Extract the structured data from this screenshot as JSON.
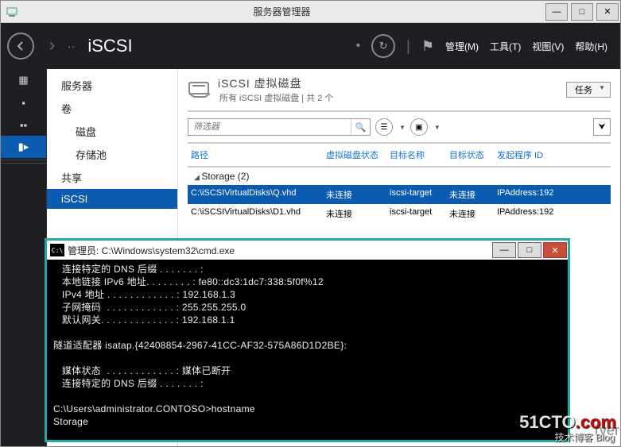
{
  "window": {
    "title": "服务器管理器",
    "min": "—",
    "max": "□",
    "close": "✕"
  },
  "header": {
    "breadcrumb": "iSCSI",
    "refresh": "↻",
    "menus": {
      "manage": "管理(M)",
      "tools": "工具(T)",
      "view": "视图(V)",
      "help": "帮助(H)"
    }
  },
  "sidebar": {
    "items": [
      "服务器",
      "卷",
      "磁盘",
      "存储池",
      "共享",
      "iSCSI"
    ]
  },
  "section": {
    "title": "iSCSI 虚拟磁盘",
    "subtitle": "所有 iSCSI 虚拟磁盘 | 共 2 个",
    "tasks_label": "任务"
  },
  "filter": {
    "placeholder": "筛选器"
  },
  "table": {
    "columns": [
      "路径",
      "虚拟磁盘状态",
      "目标名称",
      "目标状态",
      "发起程序 ID"
    ],
    "group": "Storage (2)",
    "rows": [
      {
        "path": "C:\\iSCSIVirtualDisks\\Q.vhd",
        "vstatus": "未连接",
        "target": "iscsi-target",
        "tstatus": "未连接",
        "initiator": "IPAddress:192"
      },
      {
        "path": "C:\\iSCSIVirtualDisks\\D1.vhd",
        "vstatus": "未连接",
        "target": "iscsi-target",
        "tstatus": "未连接",
        "initiator": "IPAddress:192"
      }
    ]
  },
  "cmd": {
    "title": "管理员: C:\\Windows\\system32\\cmd.exe",
    "lines": {
      "l1": "   连接特定的 DNS 后缀 . . . . . . . :",
      "l2": "   本地链接 IPv6 地址. . . . . . . . : fe80::dc3:1dc7:338:5f0f%12",
      "l3": "   IPv4 地址 . . . . . . . . . . . . : 192.168.1.3",
      "l4": "   子网掩码  . . . . . . . . . . . . : 255.255.255.0",
      "l5": "   默认网关. . . . . . . . . . . . . : 192.168.1.1",
      "l6": "",
      "l7": "隧道适配器 isatap.{42408854-2967-41CC-AF32-575A86D1D2BE}:",
      "l8": "",
      "l9": "   媒体状态  . . . . . . . . . . . . : 媒体已断开",
      "l10": "   连接特定的 DNS 后缀 . . . . . . . :",
      "l11": "",
      "l12": "C:\\Users\\administrator.CONTOSO>hostname",
      "l13": "Storage"
    }
  },
  "watermark": {
    "main": "51CTO",
    "suffix": ".com",
    "sub": "技术博客  Blog",
    "server": "rver"
  }
}
